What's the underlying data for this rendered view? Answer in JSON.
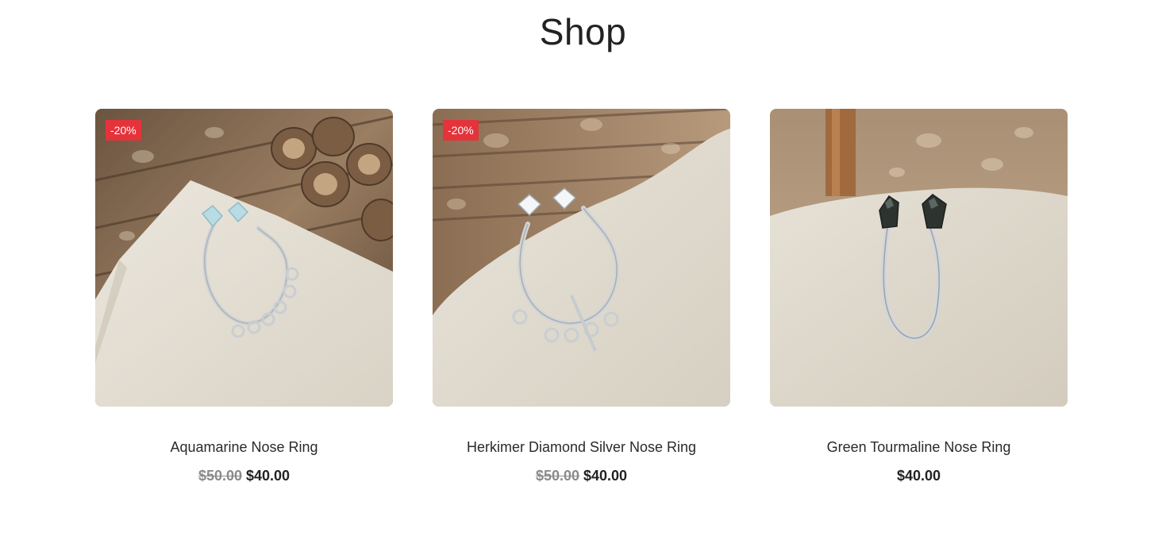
{
  "page": {
    "title": "Shop"
  },
  "colors": {
    "badge": "#e4333b",
    "old_price": "#8a8a8a",
    "text": "#222222"
  },
  "products": [
    {
      "name": "Aquamarine Nose Ring",
      "badge": "-20%",
      "old_price": "$50.00",
      "price": "$40.00",
      "image": "aquamarine-nose-ring-photo"
    },
    {
      "name": "Herkimer Diamond Silver Nose Ring",
      "badge": "-20%",
      "old_price": "$50.00",
      "price": "$40.00",
      "image": "herkimer-diamond-nose-ring-photo"
    },
    {
      "name": "Green Tourmaline Nose Ring",
      "price": "$40.00",
      "image": "green-tourmaline-nose-ring-photo"
    }
  ]
}
